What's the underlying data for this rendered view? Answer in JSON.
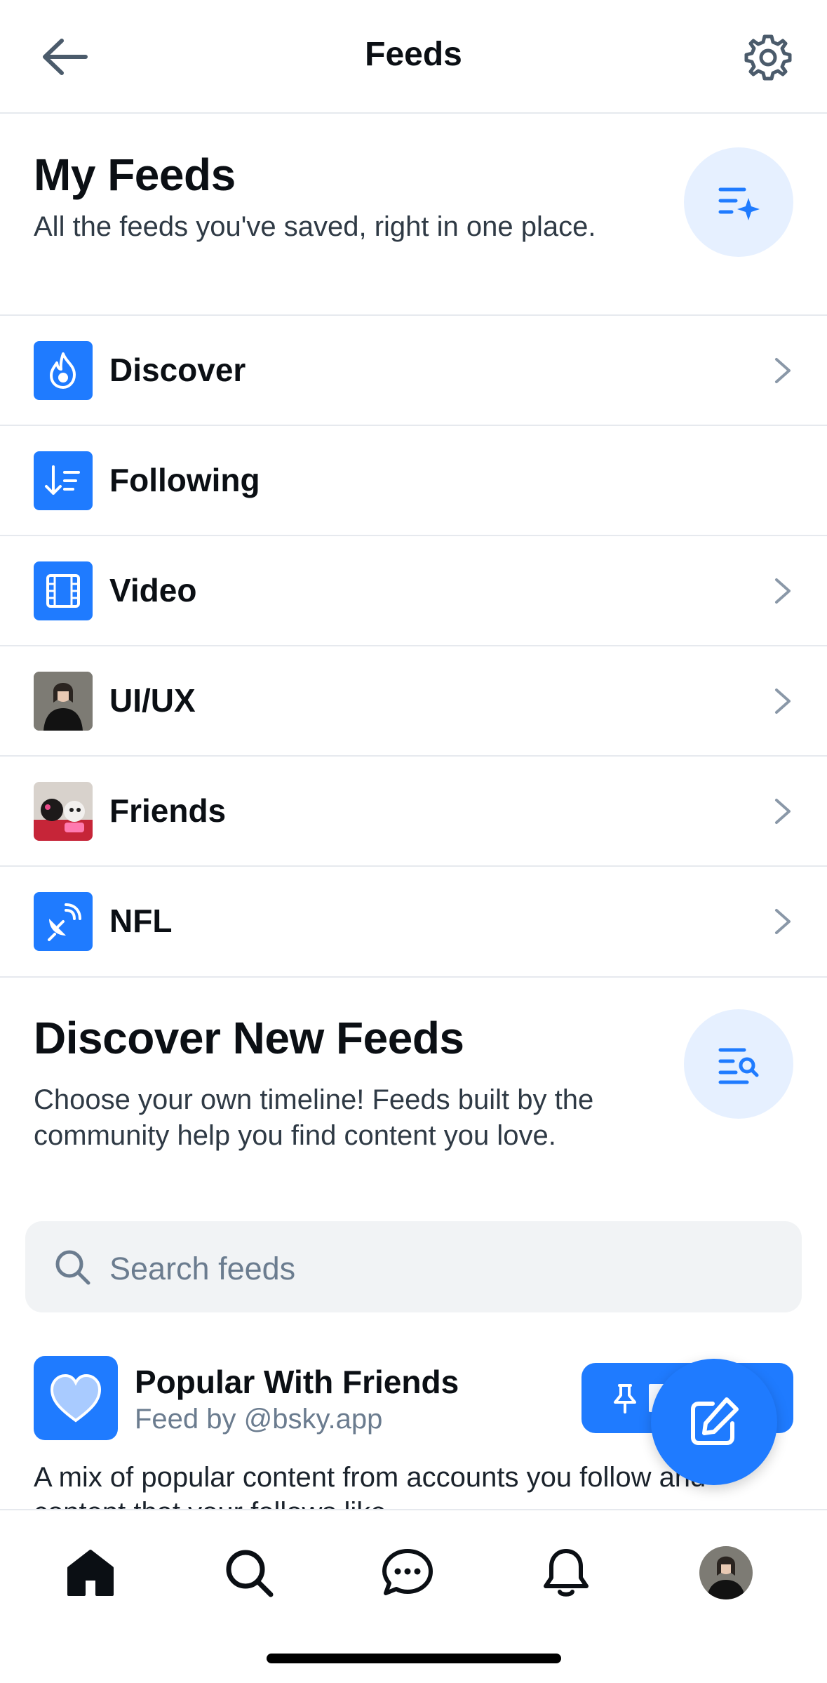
{
  "header": {
    "title": "Feeds"
  },
  "my_feeds": {
    "title": "My Feeds",
    "description": "All the feeds you've saved, right in one place."
  },
  "feeds": [
    {
      "label": "Discover",
      "icon": "flame-icon"
    },
    {
      "label": "Following",
      "icon": "sort-down-icon"
    },
    {
      "label": "Video",
      "icon": "film-icon"
    },
    {
      "label": "UI/UX",
      "icon": "person-photo"
    },
    {
      "label": "Friends",
      "icon": "dogs-photo"
    },
    {
      "label": "NFL",
      "icon": "satellite-dish-icon"
    }
  ],
  "discover": {
    "title": "Discover New Feeds",
    "description": "Choose your own timeline! Feeds built by the community help you find content you love."
  },
  "search": {
    "placeholder": "Search feeds"
  },
  "feed_card": {
    "title": "Popular With Friends",
    "subtitle": "Feed by @bsky.app",
    "description": "A mix of popular content from accounts you follow and content that your follows like."
  },
  "colors": {
    "accent": "#1f7bff",
    "accent_light": "#e6f0ff",
    "divider": "#e6e9ee"
  }
}
